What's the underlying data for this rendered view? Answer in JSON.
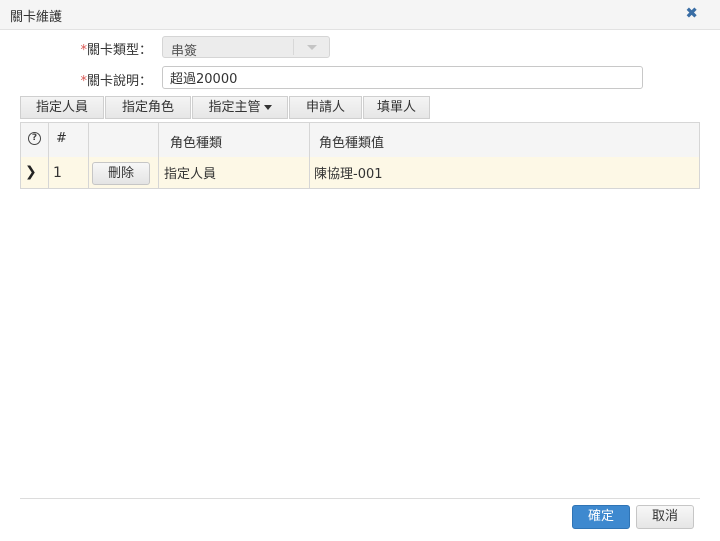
{
  "dialog": {
    "title": "關卡維護",
    "close_icon": "close-icon"
  },
  "form": {
    "type": {
      "required_mark": "*",
      "label": "關卡類型：",
      "value": "串簽"
    },
    "desc": {
      "required_mark": "*",
      "label": "關卡說明：",
      "value": "超過20000"
    }
  },
  "toolbar": {
    "items": [
      "指定人員",
      "指定角色",
      "指定主管",
      "申請人",
      "填單人"
    ]
  },
  "grid": {
    "headers": {
      "help": "?",
      "num": "#",
      "action": "",
      "role_type": "角色種類",
      "role_value": "角色種類值"
    },
    "rows": [
      {
        "num": "1",
        "delete_label": "刪除",
        "role_type": "指定人員",
        "role_value": "陳協理-001"
      }
    ]
  },
  "footer": {
    "ok_label": "確定",
    "cancel_label": "取消"
  },
  "colors": {
    "primary": "#3e89cf",
    "required": "#d9534f",
    "row_highlight": "#fdf8e6"
  }
}
